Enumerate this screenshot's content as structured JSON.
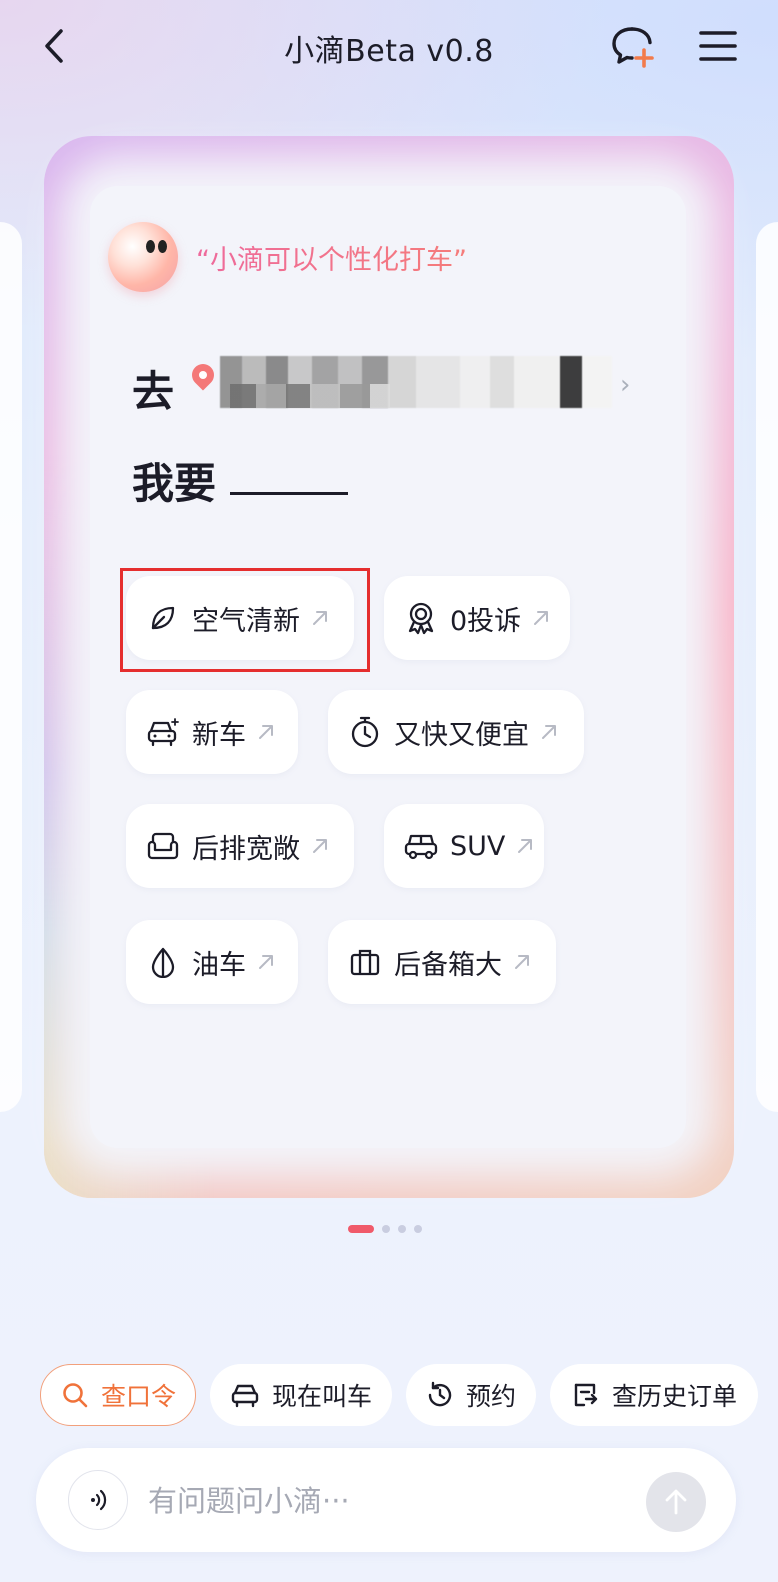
{
  "header": {
    "title": "小滴Beta v0.8"
  },
  "card": {
    "slogan": "“小滴可以个性化打车”",
    "destination_prefix": "去",
    "want_label": "我要",
    "chips": [
      {
        "label": "空气清新",
        "icon": "leaf-icon"
      },
      {
        "label": "0投诉",
        "icon": "award-icon"
      },
      {
        "label": "新车",
        "icon": "car-sparkle-icon"
      },
      {
        "label": "又快又便宜",
        "icon": "stopwatch-icon"
      },
      {
        "label": "后排宽敞",
        "icon": "sofa-icon"
      },
      {
        "label": "SUV",
        "icon": "suv-icon"
      },
      {
        "label": "油车",
        "icon": "droplet-icon"
      },
      {
        "label": "后备箱大",
        "icon": "suitcase-icon"
      }
    ]
  },
  "pager": {
    "count": 4,
    "active": 0
  },
  "quick_actions": [
    {
      "label": "查口令",
      "icon": "search-icon"
    },
    {
      "label": "现在叫车",
      "icon": "car-icon"
    },
    {
      "label": "预约",
      "icon": "clock-icon"
    },
    {
      "label": "查历史订单",
      "icon": "history-order-icon"
    }
  ],
  "input": {
    "placeholder": "有问题问小滴···",
    "value": ""
  },
  "colors": {
    "accent": "#f05a6a",
    "primary_action": "#f0723a",
    "highlight_box": "#e52e2e"
  }
}
